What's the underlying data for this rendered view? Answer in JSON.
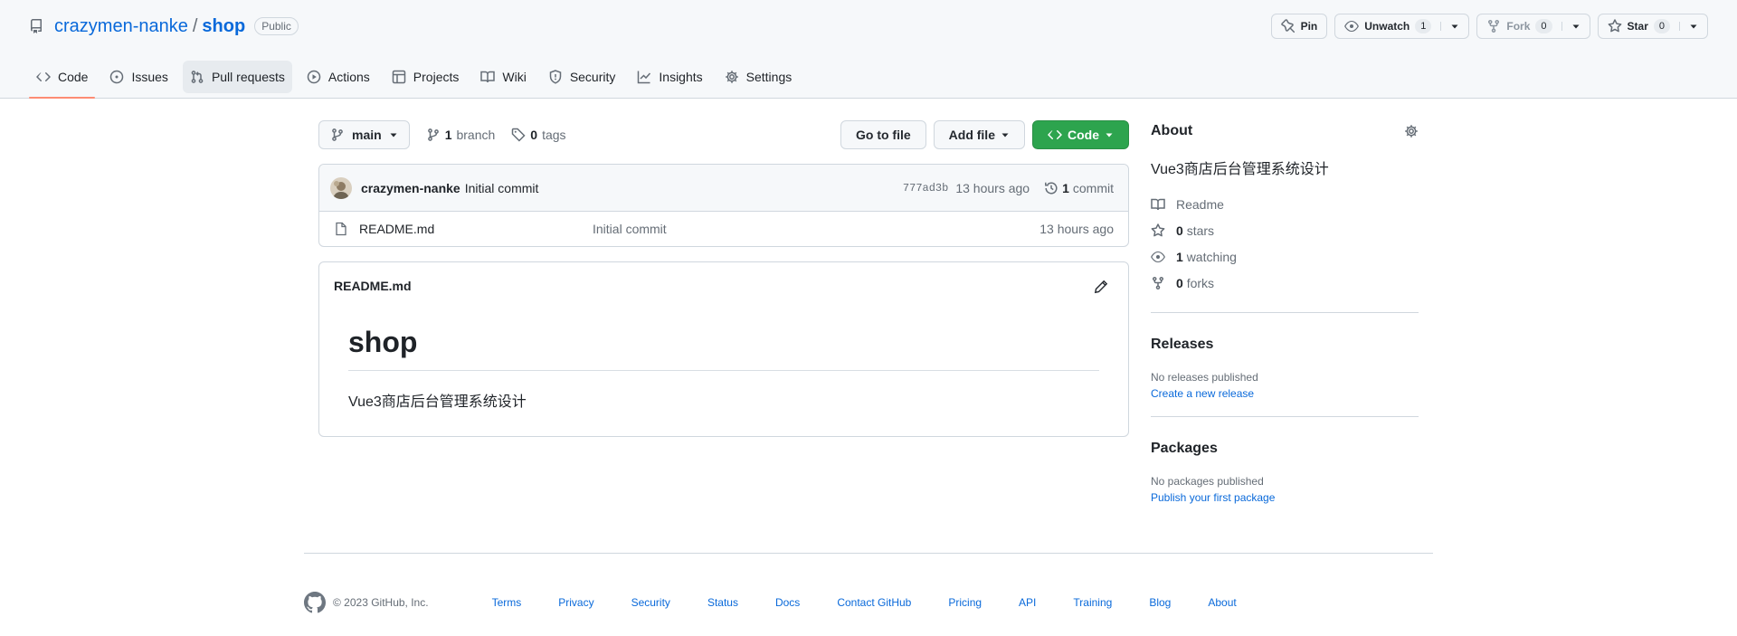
{
  "repo": {
    "owner": "crazymen-nanke",
    "separator": "/",
    "name": "shop",
    "visibility": "Public"
  },
  "header_actions": {
    "pin": "Pin",
    "unwatch": "Unwatch",
    "watch_count": "1",
    "fork": "Fork",
    "fork_count": "0",
    "star": "Star",
    "star_count": "0"
  },
  "tabs": [
    {
      "label": "Code",
      "icon": "code-icon"
    },
    {
      "label": "Issues",
      "icon": "issue-icon"
    },
    {
      "label": "Pull requests",
      "icon": "pull-request-icon"
    },
    {
      "label": "Actions",
      "icon": "play-icon"
    },
    {
      "label": "Projects",
      "icon": "table-icon"
    },
    {
      "label": "Wiki",
      "icon": "book-icon"
    },
    {
      "label": "Security",
      "icon": "shield-icon"
    },
    {
      "label": "Insights",
      "icon": "graph-icon"
    },
    {
      "label": "Settings",
      "icon": "gear-icon"
    }
  ],
  "toolbar": {
    "branch": "main",
    "branch_count": "1",
    "branch_label": "branch",
    "tag_count": "0",
    "tag_label": "tags",
    "goto_file": "Go to file",
    "add_file": "Add file",
    "code": "Code"
  },
  "latest_commit": {
    "author": "crazymen-nanke",
    "message": "Initial commit",
    "sha": "777ad3b",
    "time": "13 hours ago",
    "count": "1",
    "count_label": "commit"
  },
  "files": [
    {
      "name": "README.md",
      "message": "Initial commit",
      "time": "13 hours ago"
    }
  ],
  "readme": {
    "filename": "README.md",
    "heading": "shop",
    "body": "Vue3商店后台管理系统设计"
  },
  "about": {
    "title": "About",
    "description": "Vue3商店后台管理系统设计",
    "readme": "Readme",
    "stars_count": "0",
    "stars_label": "stars",
    "watching_count": "1",
    "watching_label": "watching",
    "forks_count": "0",
    "forks_label": "forks"
  },
  "releases": {
    "title": "Releases",
    "empty": "No releases published",
    "link": "Create a new release"
  },
  "packages": {
    "title": "Packages",
    "empty": "No packages published",
    "link": "Publish your first package"
  },
  "footer": {
    "copyright": "© 2023 GitHub, Inc.",
    "links": [
      "Terms",
      "Privacy",
      "Security",
      "Status",
      "Docs",
      "Contact GitHub",
      "Pricing",
      "API",
      "Training",
      "Blog",
      "About"
    ]
  },
  "colors": {
    "accent_link": "#0969da",
    "primary_button": "#2da44e",
    "active_tab_underline": "#fd8c73",
    "header_bg": "#f6f8fa",
    "border": "#d0d7de"
  }
}
